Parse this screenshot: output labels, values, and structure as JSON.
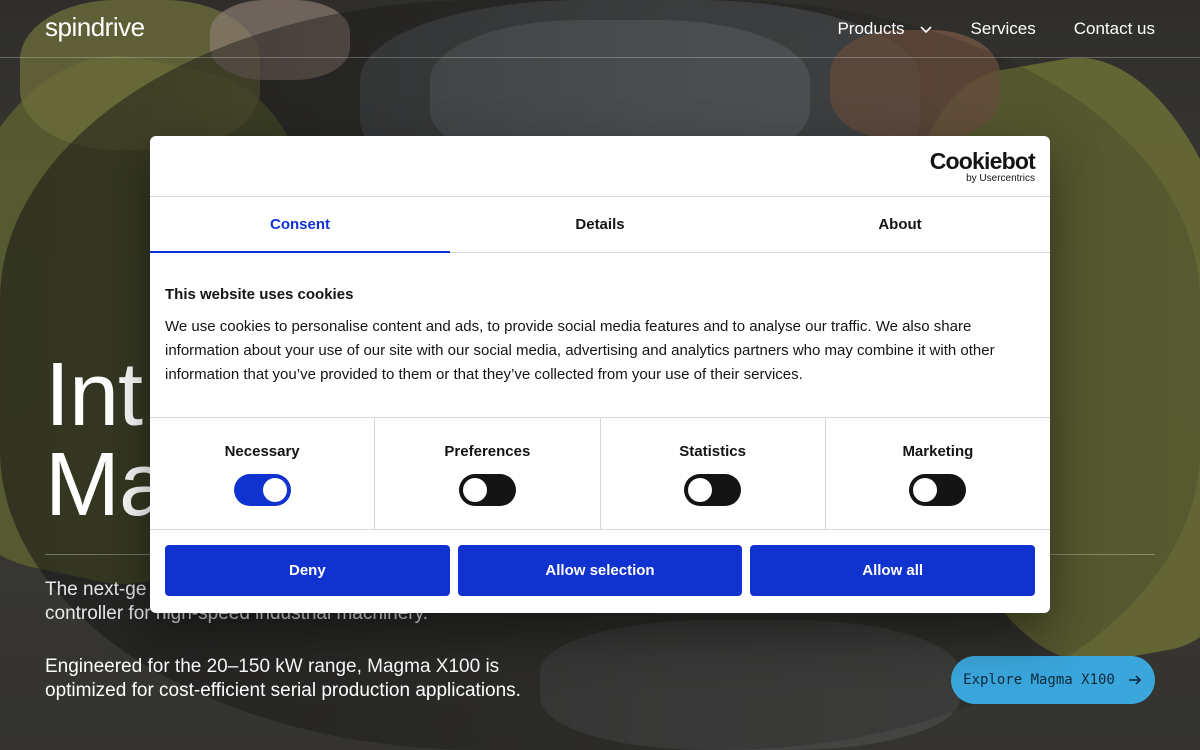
{
  "brand": {
    "logo_text": "spindrive"
  },
  "nav": {
    "products_label": "Products",
    "services_label": "Services",
    "contact_label": "Contact us"
  },
  "hero": {
    "title_line1": "Int",
    "title_line2": "Ma",
    "subtitle": "The next-ge                                                  controller for high-speed industrial machinery.",
    "subtitle_visible_start": "The next-ge",
    "subtitle_visible_end": "controller for high-speed industrial machinery.",
    "description": "Engineered for the 20–150 kW range, Magma X100 is optimized for cost-efficient serial production applications.",
    "cta_label": "Explore Magma X100",
    "cta_color": "#3aa6dc"
  },
  "cookie_dialog": {
    "provider_logo": "Cookiebot",
    "provider_sub": "by Usercentrics",
    "tabs": [
      {
        "label": "Consent",
        "active": true
      },
      {
        "label": "Details",
        "active": false
      },
      {
        "label": "About",
        "active": false
      }
    ],
    "heading": "This website uses cookies",
    "body": "We use cookies to personalise content and ads, to provide social media features and to analyse our traffic. We also share information about your use of our site with our social media, advertising and analytics partners who may combine it with other information that you’ve provided to them or that they’ve collected from your use of their services.",
    "toggles": [
      {
        "label": "Necessary",
        "on": true
      },
      {
        "label": "Preferences",
        "on": false
      },
      {
        "label": "Statistics",
        "on": false
      },
      {
        "label": "Marketing",
        "on": false
      }
    ],
    "buttons": {
      "deny": "Deny",
      "allow_selection": "Allow selection",
      "allow_all": "Allow all"
    },
    "accent_color": "#1032cf"
  }
}
